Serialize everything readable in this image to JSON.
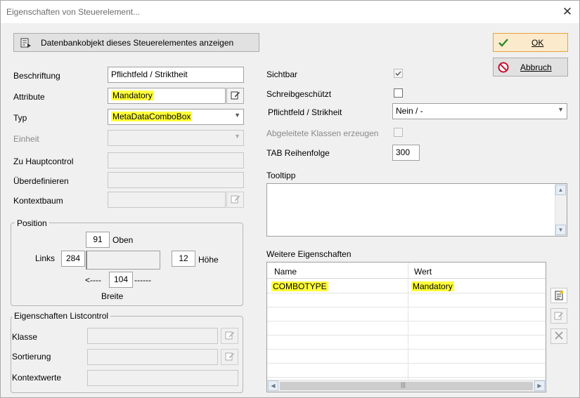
{
  "window": {
    "title": "Eigenschaften von Steuerelement..."
  },
  "buttons": {
    "show_db_object": "Datenbankobjekt dieses Steuerelementes anzeigen",
    "ok": "OK",
    "cancel": "Abbruch"
  },
  "left": {
    "caption_label": "Beschriftung",
    "caption_value": "Pflichtfeld / Striktheit",
    "attribute_label": "Attribute",
    "attribute_value": "Mandatory",
    "type_label": "Typ",
    "type_value": "MetaDataComboBox",
    "unit_label": "Einheit",
    "main_control_label": "Zu Hauptcontrol",
    "override_label": "Überdefinieren",
    "context_tree_label": "Kontextbaum"
  },
  "position": {
    "title": "Position",
    "top_label": "Oben",
    "top_value": "91",
    "left_label": "Links",
    "left_value": "284",
    "height_label": "Höhe",
    "height_value": "12",
    "width_value": "104",
    "width_label": "Breite",
    "arrow_left": "<----",
    "arrow_right": "------"
  },
  "listcontrol": {
    "title": "Eigenschaften Listcontrol",
    "class_label": "Klasse",
    "sort_label": "Sortierung",
    "context_values_label": "Kontextwerte"
  },
  "right": {
    "visible_label": "Sichtbar",
    "visible_checked": true,
    "readonly_label": "Schreibgeschützt",
    "readonly_checked": false,
    "required_label": "Pflichtfeld / Strikheit",
    "required_value": "Nein / -",
    "derived_label": "Abgeleitete Klassen erzeugen",
    "derived_checked": false,
    "tab_order_label": "TAB Reihenfolge",
    "tab_order_value": "300",
    "tooltip_label": "Tooltipp",
    "more_props_label": "Weitere Eigenschaften"
  },
  "grid": {
    "columns": [
      "Name",
      "Wert"
    ],
    "rows": [
      {
        "name": "COMBOTYPE",
        "value": "Mandatory"
      }
    ]
  },
  "icons": {
    "db": "database-object-icon",
    "ok": "check-icon",
    "cancel": "no-entry-icon",
    "edit": "edit-icon",
    "new": "new-item-icon",
    "delete": "delete-x-icon"
  },
  "colors": {
    "highlight": "#ffff3b",
    "ok_border": "#e8a33d",
    "check_green": "#2a8a2a",
    "cancel_red": "#c8102e"
  }
}
